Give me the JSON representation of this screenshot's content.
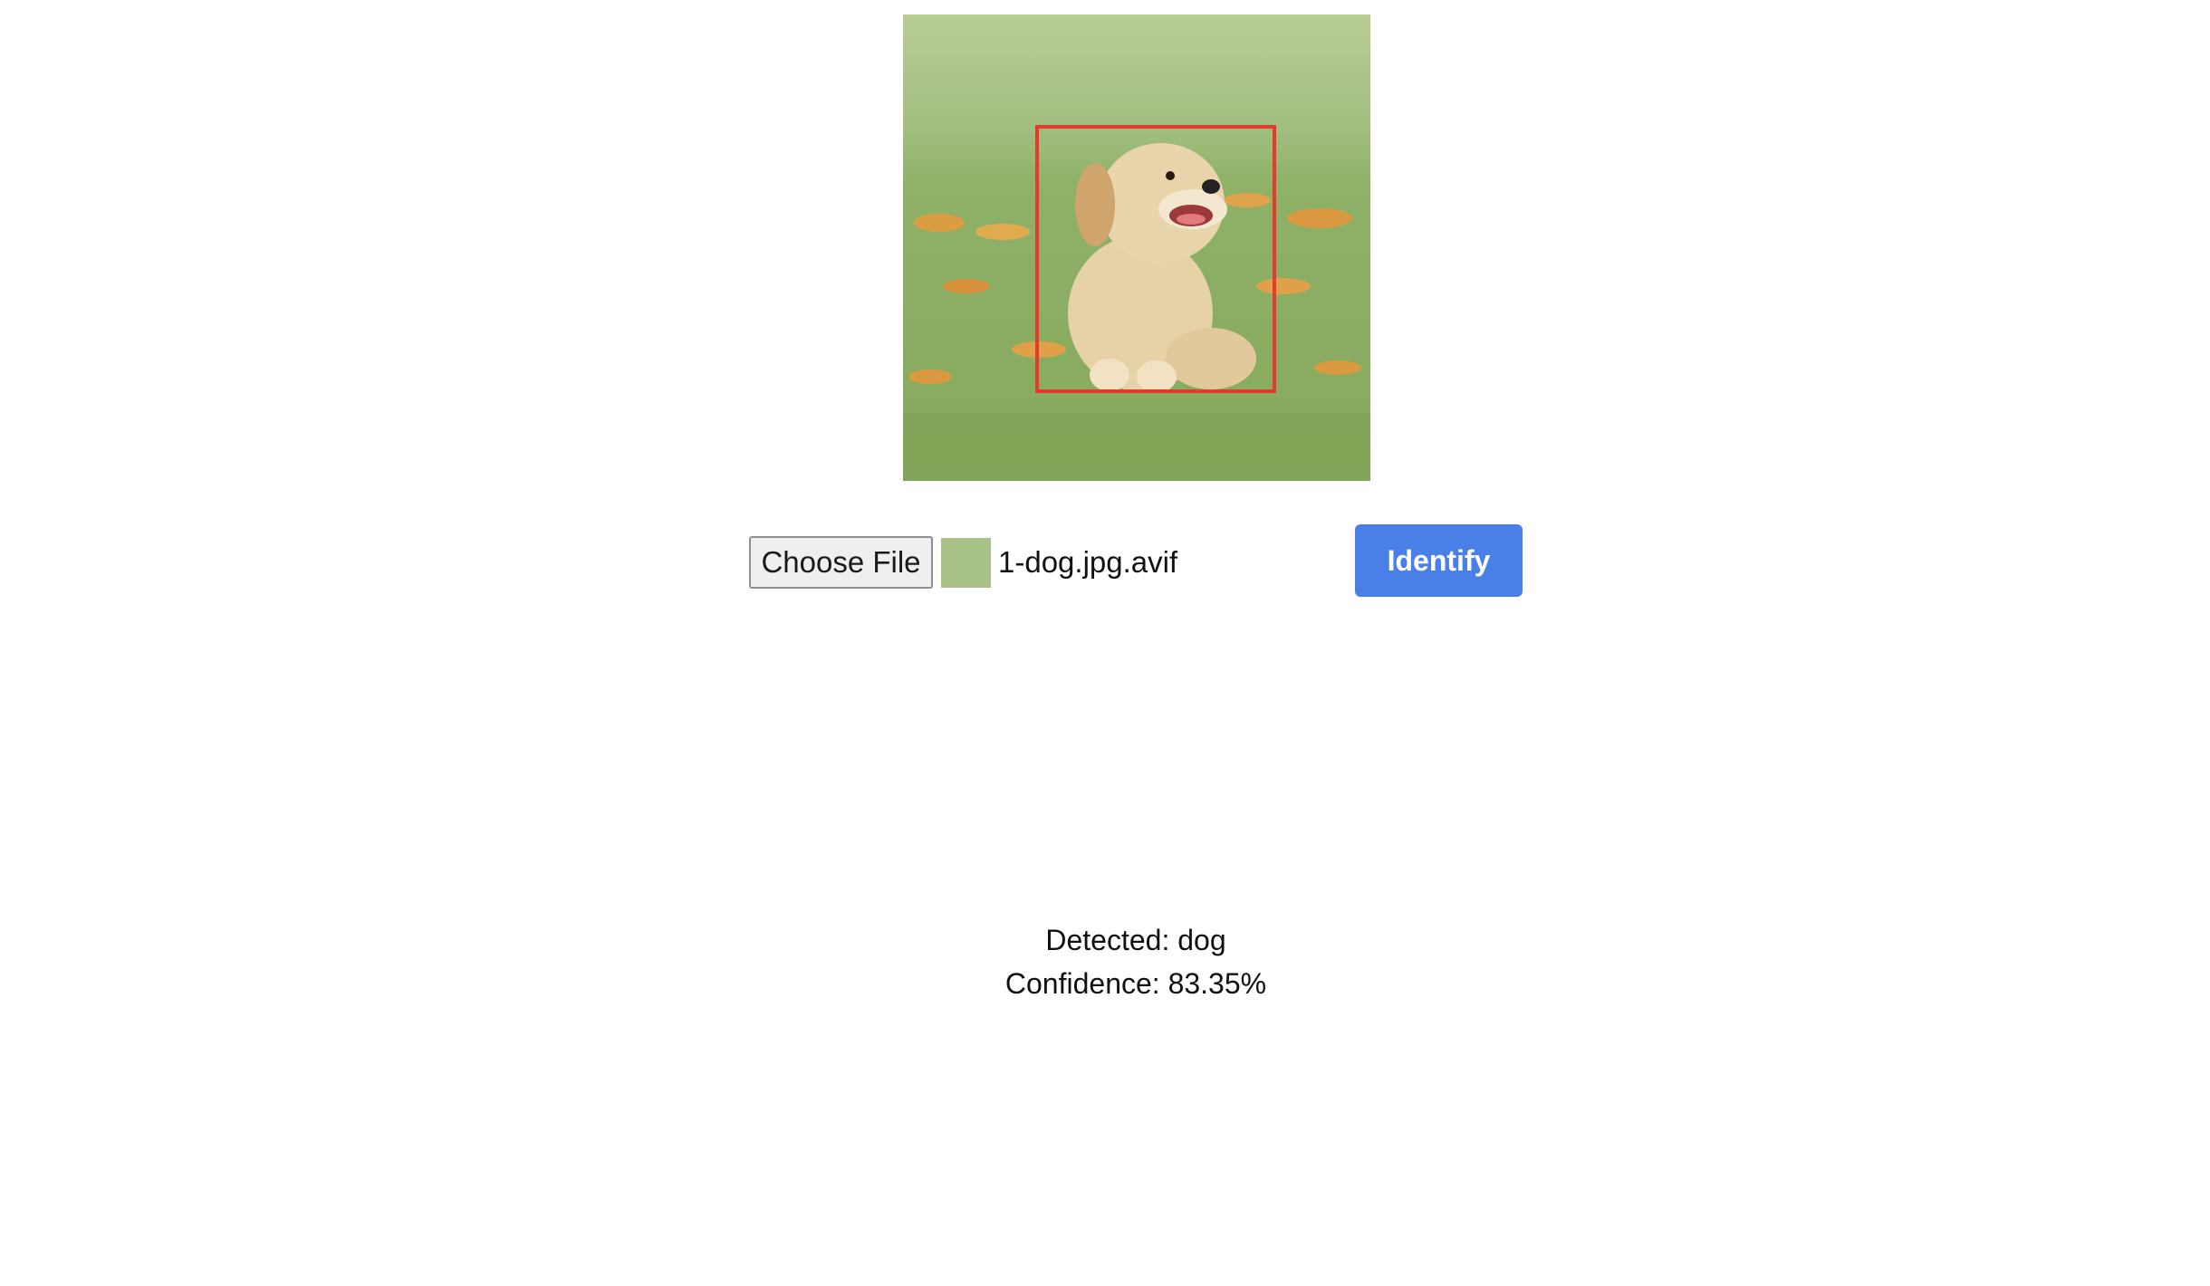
{
  "preview": {
    "icon": "dog-photo",
    "bbox_color": "#e53a2c"
  },
  "controls": {
    "choose_file_label": "Choose File",
    "file_name": "1-dog.jpg.avif",
    "identify_label": "Identify",
    "identify_color": "#4a7fe8"
  },
  "result": {
    "detected_text": "Detected: dog",
    "confidence_text": "Confidence: 83.35%"
  }
}
